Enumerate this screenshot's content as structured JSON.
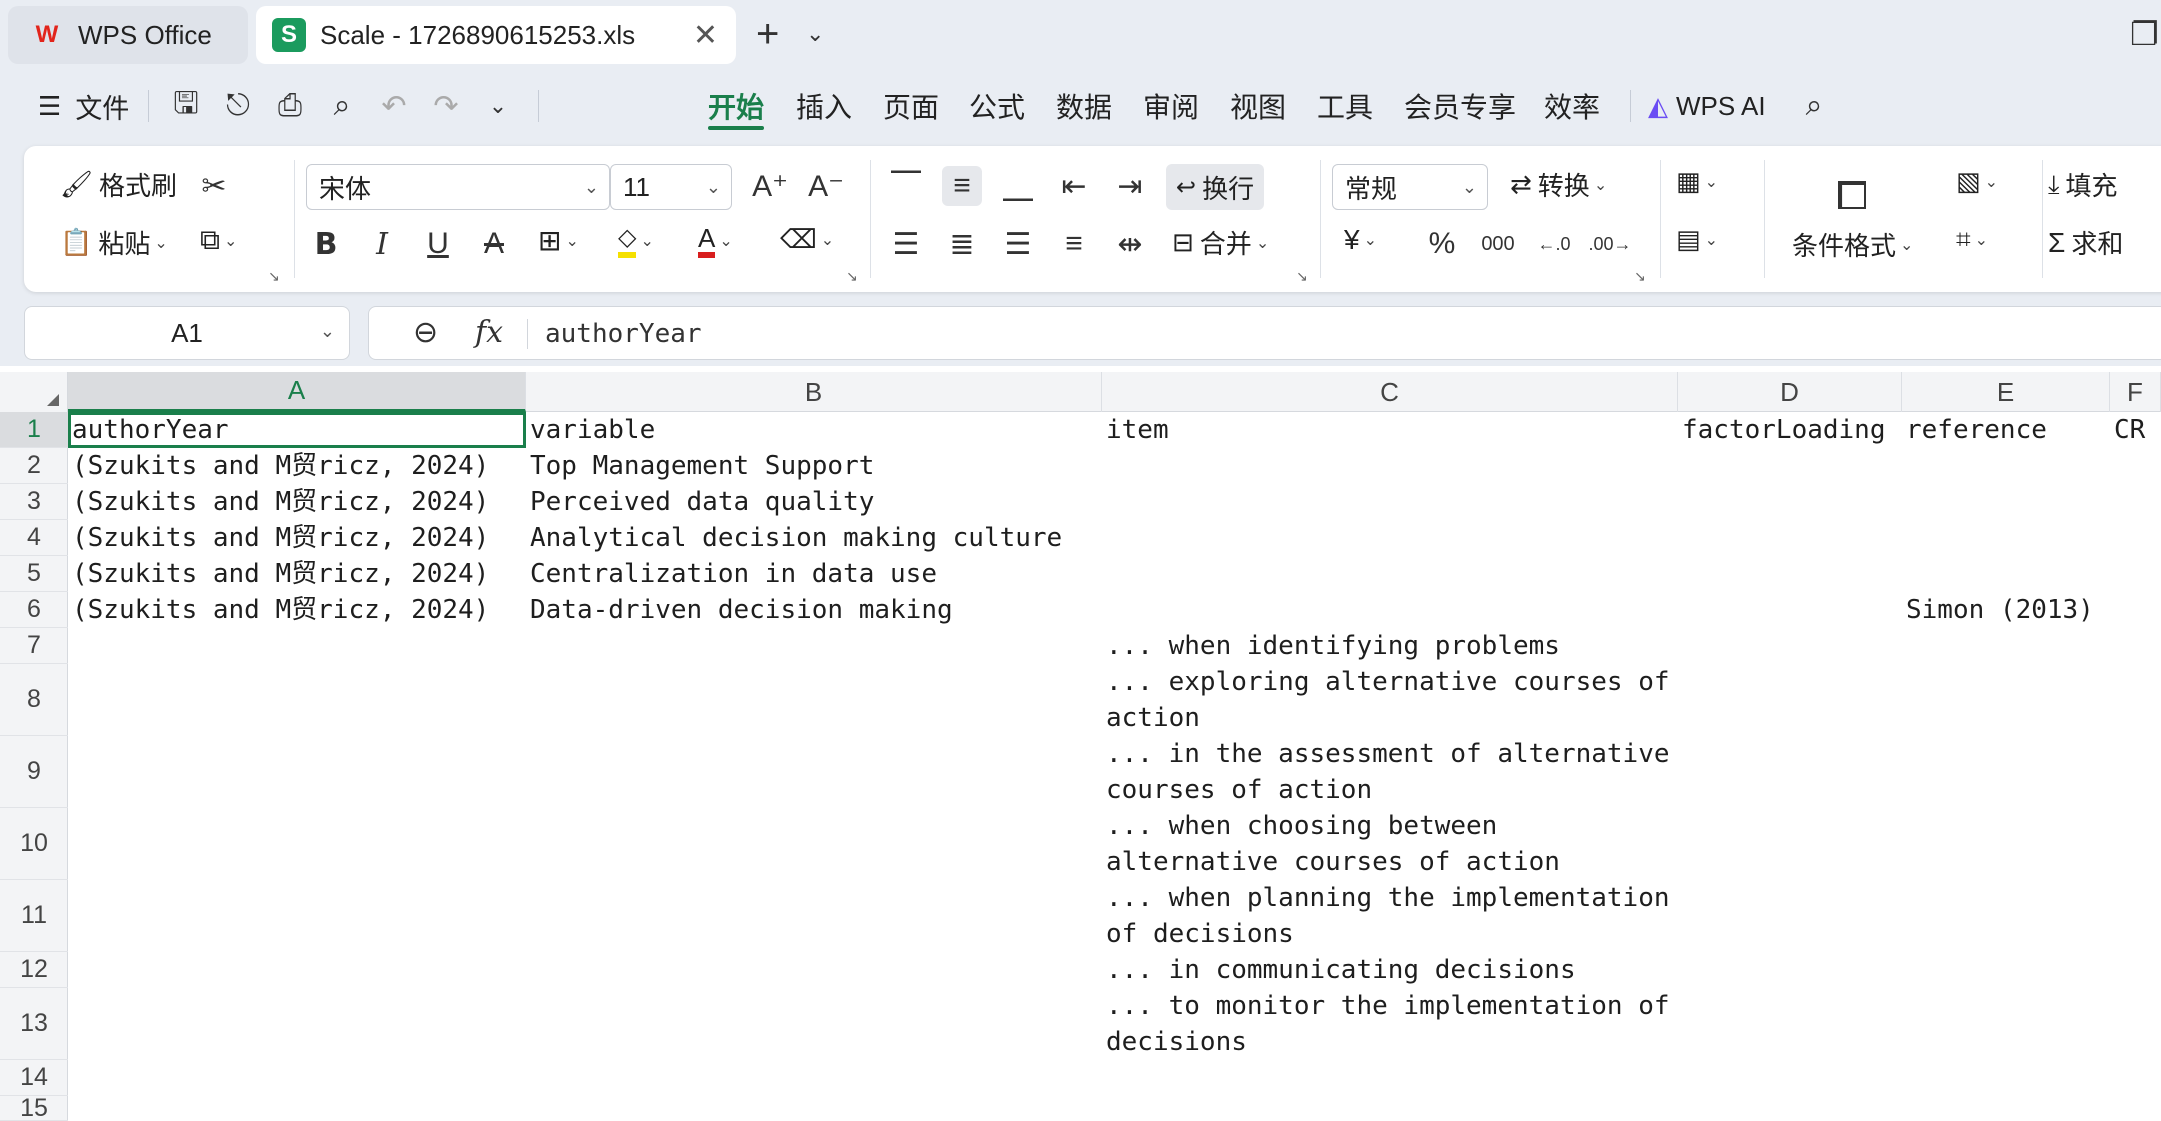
{
  "titlebar": {
    "app_tab": "WPS Office",
    "file_tab": "Scale - 1726890615253.xls"
  },
  "menubar": {
    "file_menu": "文件",
    "tabs": [
      "开始",
      "插入",
      "页面",
      "公式",
      "数据",
      "审阅",
      "视图",
      "工具",
      "会员专享",
      "效率"
    ],
    "active_tab": "开始",
    "ai_label": "WPS AI"
  },
  "ribbon": {
    "format_painter": "格式刷",
    "paste": "粘贴",
    "font_name": "宋体",
    "font_size": "11",
    "wrap_text": "换行",
    "merge": "合并",
    "number_format": "常规",
    "convert": "转换",
    "conditional_format": "条件格式",
    "fill": "填充",
    "sum": "求和",
    "font_color": "#d81e1e",
    "highlight_color": "#f5e000"
  },
  "formula_bar": {
    "cell_ref": "A1",
    "value": "authorYear"
  },
  "sheet": {
    "columns": [
      "A",
      "B",
      "C",
      "D",
      "E",
      "F"
    ],
    "rows": [
      "1",
      "2",
      "3",
      "4",
      "5",
      "6",
      "7",
      "8",
      "9",
      "10",
      "11",
      "12",
      "13",
      "14",
      "15"
    ],
    "cells": {
      "A1": "authorYear",
      "B1": "variable",
      "C1": "item",
      "D1": "factorLoading",
      "E1": "reference",
      "F1": "CR",
      "A2": "(Szukits and M贸ricz, 2024)",
      "B2": "Top Management Support",
      "A3": "(Szukits and M贸ricz, 2024)",
      "B3": "Perceived data quality",
      "A4": "(Szukits and M贸ricz, 2024)",
      "B4": "Analytical decision making culture",
      "A5": "(Szukits and M贸ricz, 2024)",
      "B5": "Centralization in data use",
      "A6": "(Szukits and M贸ricz, 2024)",
      "B6": "Data-driven decision making",
      "E6": "Simon (2013)",
      "C7": "... when identifying problems",
      "C8": "... exploring alternative courses of action",
      "C9": "... in the assessment of alternative courses of action",
      "C10": "... when choosing between alternative courses of action",
      "C11": "... when planning the implementation of decisions",
      "C12": "... in communicating decisions",
      "C13": "... to monitor the implementation of decisions"
    }
  }
}
